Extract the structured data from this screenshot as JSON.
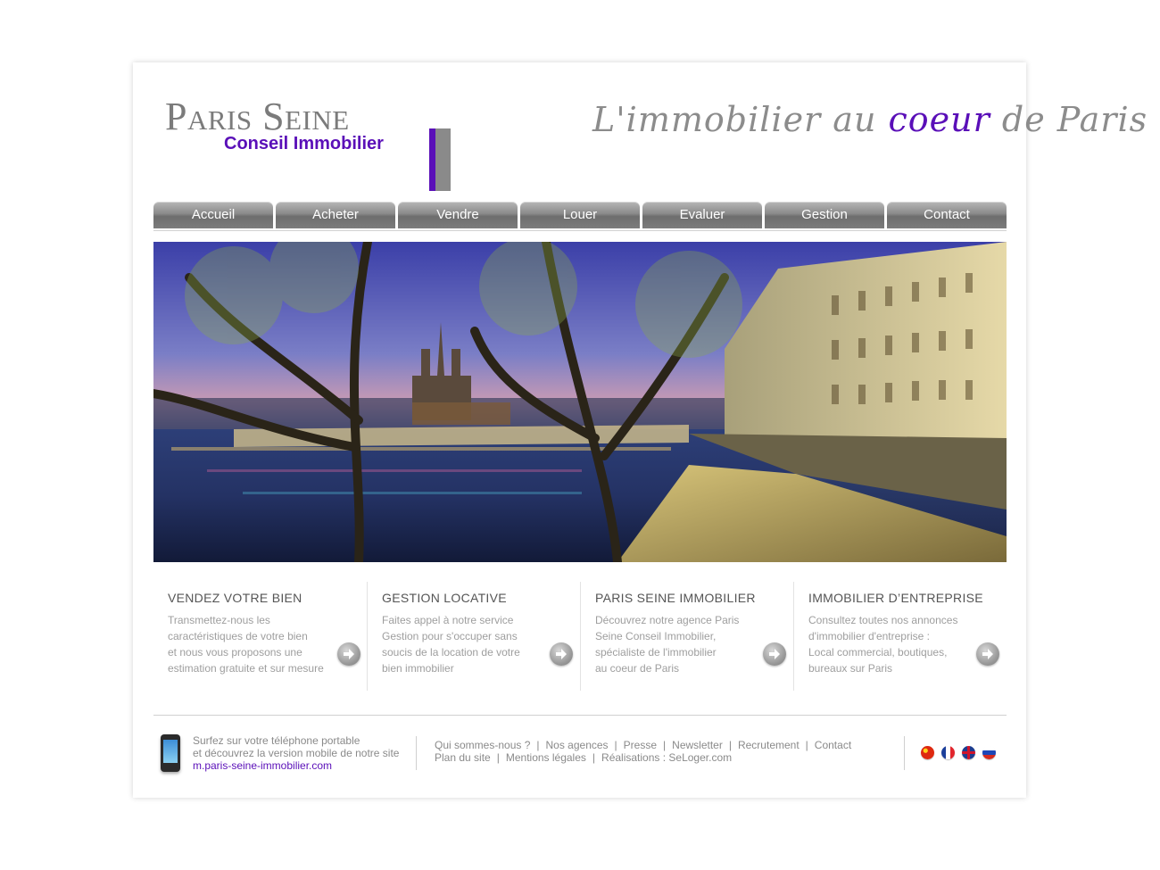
{
  "logo": {
    "title": "Paris Seine",
    "subtitle": "Conseil Immobilier"
  },
  "tagline": {
    "part1": "L'immobilier au ",
    "accent": "coeur",
    "part2": " de Paris"
  },
  "nav": {
    "items": [
      {
        "label": "Accueil"
      },
      {
        "label": "Acheter"
      },
      {
        "label": "Vendre"
      },
      {
        "label": "Louer"
      },
      {
        "label": "Evaluer"
      },
      {
        "label": "Gestion"
      },
      {
        "label": "Contact"
      }
    ]
  },
  "features": [
    {
      "title": "VENDEZ VOTRE BIEN",
      "lines": [
        "Transmettez-nous les",
        "caractéristiques de votre bien",
        "et nous vous proposons une",
        "estimation gratuite et sur mesure"
      ]
    },
    {
      "title": "GESTION LOCATIVE",
      "lines": [
        "Faites appel à notre service",
        "Gestion pour s'occuper sans",
        "soucis de la location de votre",
        "bien immobilier"
      ]
    },
    {
      "title": "PARIS SEINE IMMOBILIER",
      "lines": [
        "Découvrez notre agence Paris",
        "Seine Conseil Immobilier,",
        "spécialiste de l'immobilier",
        "au coeur de Paris"
      ]
    },
    {
      "title": "IMMOBILIER D’ENTREPRISE",
      "lines": [
        "Consultez toutes nos annonces",
        "d'immobilier d'entreprise :",
        "Local commercial, boutiques,",
        "bureaux sur Paris"
      ]
    }
  ],
  "footer": {
    "mobile": {
      "line1": "Surfez sur votre téléphone portable",
      "line2": "et découvrez la version mobile de notre site",
      "link": "m.paris-seine-immobilier.com"
    },
    "links_row1": [
      "Qui sommes-nous ?",
      "Nos agences",
      "Presse",
      "Newsletter",
      "Recrutement",
      "Contact"
    ],
    "links_row2": [
      "Plan du site",
      "Mentions légales",
      "Réalisations : SeLoger.com"
    ],
    "separator": "|",
    "flags": [
      "china-flag",
      "france-flag",
      "uk-flag",
      "russia-flag"
    ]
  },
  "colors": {
    "accent": "#5a0fb8",
    "logo_gray": "#7b7b7b",
    "nav_gray": "#7c7c7c"
  }
}
